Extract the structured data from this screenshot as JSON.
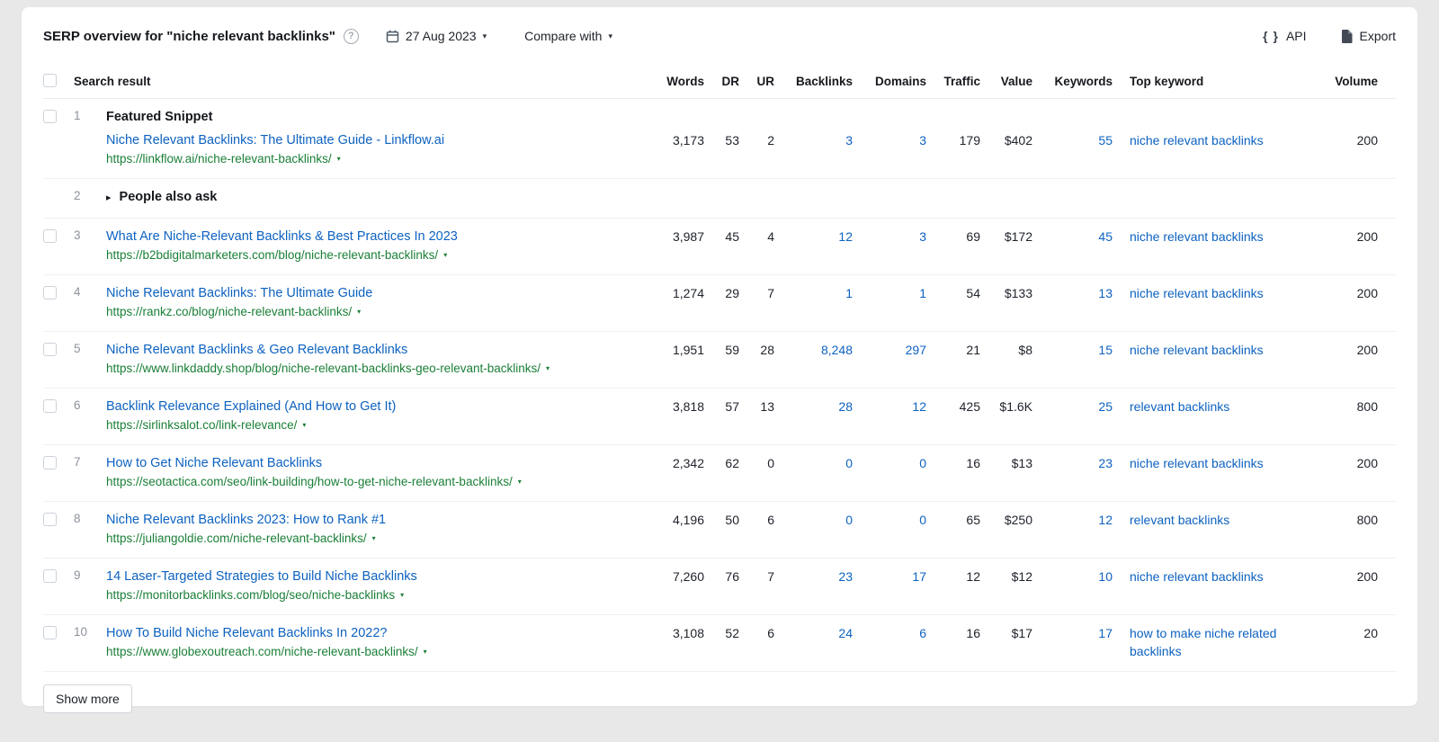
{
  "colors": {
    "link_blue": "#0d62c0",
    "url_green": "#1a7f37",
    "text_dark": "#20242c",
    "page_bg": "#e8e8e8"
  },
  "icons": {
    "help": "?",
    "caret_down": "▾",
    "caret_right": "▸",
    "braces": "{ }",
    "url_caret": "▾"
  },
  "header": {
    "title": "SERP overview for \"niche relevant backlinks\"",
    "date": "27 Aug 2023",
    "compare_label": "Compare with",
    "api_label": "API",
    "export_label": "Export"
  },
  "table": {
    "columns": [
      "Search result",
      "Words",
      "DR",
      "UR",
      "Backlinks",
      "Domains",
      "Traffic",
      "Value",
      "Keywords",
      "Top keyword",
      "Volume"
    ],
    "rows": [
      {
        "index": "1",
        "type": "featured",
        "badge": "Featured Snippet",
        "title": "Niche Relevant Backlinks: The Ultimate Guide - Linkflow.ai",
        "url": "https://linkflow.ai/niche-relevant-backlinks/",
        "words": "3,173",
        "dr": "53",
        "ur": "2",
        "backlinks": "3",
        "domains": "3",
        "traffic": "179",
        "value": "$402",
        "keywords": "55",
        "top_keyword": "niche relevant backlinks",
        "volume": "200"
      },
      {
        "index": "2",
        "type": "paa",
        "title": "People also ask"
      },
      {
        "index": "3",
        "type": "result",
        "title": "What Are Niche-Relevant Backlinks & Best Practices In 2023",
        "url": "https://b2bdigitalmarketers.com/blog/niche-relevant-backlinks/",
        "words": "3,987",
        "dr": "45",
        "ur": "4",
        "backlinks": "12",
        "domains": "3",
        "traffic": "69",
        "value": "$172",
        "keywords": "45",
        "top_keyword": "niche relevant backlinks",
        "volume": "200"
      },
      {
        "index": "4",
        "type": "result",
        "title": "Niche Relevant Backlinks: The Ultimate Guide",
        "url": "https://rankz.co/blog/niche-relevant-backlinks/",
        "words": "1,274",
        "dr": "29",
        "ur": "7",
        "backlinks": "1",
        "domains": "1",
        "traffic": "54",
        "value": "$133",
        "keywords": "13",
        "top_keyword": "niche relevant backlinks",
        "volume": "200"
      },
      {
        "index": "5",
        "type": "result",
        "title": "Niche Relevant Backlinks & Geo Relevant Backlinks",
        "url": "https://www.linkdaddy.shop/blog/niche-relevant-backlinks-geo-relevant-backlinks/",
        "words": "1,951",
        "dr": "59",
        "ur": "28",
        "backlinks": "8,248",
        "domains": "297",
        "traffic": "21",
        "value": "$8",
        "keywords": "15",
        "top_keyword": "niche relevant backlinks",
        "volume": "200"
      },
      {
        "index": "6",
        "type": "result",
        "title": "Backlink Relevance Explained (And How to Get It)",
        "url": "https://sirlinksalot.co/link-relevance/",
        "words": "3,818",
        "dr": "57",
        "ur": "13",
        "backlinks": "28",
        "domains": "12",
        "traffic": "425",
        "value": "$1.6K",
        "keywords": "25",
        "top_keyword": "relevant backlinks",
        "volume": "800"
      },
      {
        "index": "7",
        "type": "result",
        "title": "How to Get Niche Relevant Backlinks",
        "url": "https://seotactica.com/seo/link-building/how-to-get-niche-relevant-backlinks/",
        "words": "2,342",
        "dr": "62",
        "ur": "0",
        "backlinks": "0",
        "domains": "0",
        "traffic": "16",
        "value": "$13",
        "keywords": "23",
        "top_keyword": "niche relevant backlinks",
        "volume": "200"
      },
      {
        "index": "8",
        "type": "result",
        "title": "Niche Relevant Backlinks 2023: How to Rank #1",
        "url": "https://juliangoldie.com/niche-relevant-backlinks/",
        "words": "4,196",
        "dr": "50",
        "ur": "6",
        "backlinks": "0",
        "domains": "0",
        "traffic": "65",
        "value": "$250",
        "keywords": "12",
        "top_keyword": "relevant backlinks",
        "volume": "800"
      },
      {
        "index": "9",
        "type": "result",
        "title": "14 Laser-Targeted Strategies to Build Niche Backlinks",
        "url": "https://monitorbacklinks.com/blog/seo/niche-backlinks",
        "words": "7,260",
        "dr": "76",
        "ur": "7",
        "backlinks": "23",
        "domains": "17",
        "traffic": "12",
        "value": "$12",
        "keywords": "10",
        "top_keyword": "niche relevant backlinks",
        "volume": "200"
      },
      {
        "index": "10",
        "type": "result",
        "title": "How To Build Niche Relevant Backlinks In 2022?",
        "url": "https://www.globexoutreach.com/niche-relevant-backlinks/",
        "words": "3,108",
        "dr": "52",
        "ur": "6",
        "backlinks": "24",
        "domains": "6",
        "traffic": "16",
        "value": "$17",
        "keywords": "17",
        "top_keyword": "how to make niche related backlinks",
        "volume": "20"
      }
    ],
    "show_more": "Show more"
  }
}
